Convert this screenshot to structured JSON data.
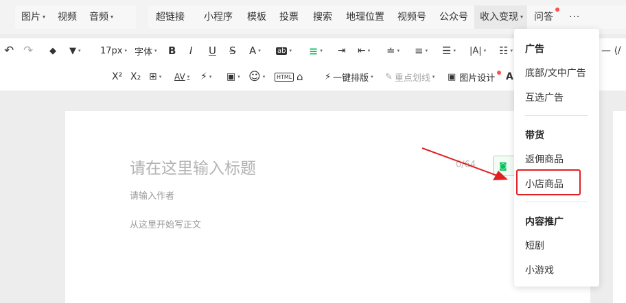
{
  "topbar": {
    "group1": [
      {
        "label": "图片",
        "caret": "▾"
      },
      {
        "label": "视频",
        "caret": ""
      },
      {
        "label": "音频",
        "caret": "▾"
      }
    ],
    "group2": [
      {
        "label": "超链接"
      },
      {
        "label": "小程序"
      },
      {
        "label": "模板"
      },
      {
        "label": "投票"
      },
      {
        "label": "搜索"
      },
      {
        "label": "地理位置"
      },
      {
        "label": "视频号"
      },
      {
        "label": "公众号"
      }
    ],
    "income": {
      "label": "收入变现",
      "caret": "▾"
    },
    "qa": {
      "label": "问答"
    },
    "more": "···"
  },
  "toolbar": {
    "undo": "↶",
    "redo": "↷",
    "format_brush": "◆",
    "clear": "▼",
    "font_size": "17px",
    "font_family": "字体",
    "bold": "B",
    "italic": "I",
    "underline": "U",
    "strike": "S",
    "font_color": "A",
    "bg_color": "ab",
    "align": "≡",
    "indent1": "⇥",
    "indent2": "⇤",
    "line_height": "≐",
    "spacing1": "≡",
    "spacing2": "☰",
    "text_dir": "|A|",
    "list": "☷",
    "super": "X²",
    "sub": "X₂",
    "table": "⊞",
    "av": "AV",
    "magic": "⚡",
    "chart": "▣",
    "emoji": "☺",
    "html": "HTML",
    "bag": "⌂",
    "one_key": "一键排版",
    "highlight": "重点划线",
    "image_design": "图片设计",
    "last_a": "A"
  },
  "editor": {
    "title_placeholder": "请在这里输入标题",
    "counter": "0/64",
    "author_placeholder": "请输入作者",
    "body_placeholder": "从这里开始写正文"
  },
  "dropdown": {
    "sections": [
      {
        "head": "广告",
        "items": [
          "底部/文中广告",
          "互选广告"
        ]
      },
      {
        "head": "带货",
        "items": [
          "返佣商品",
          "小店商品"
        ]
      },
      {
        "head": "内容推广",
        "items": [
          "短剧",
          "小游戏"
        ]
      }
    ]
  },
  "colors": {
    "accent_green": "#07c160",
    "highlight_red": "#e02020",
    "badge_red": "#fa5151"
  }
}
